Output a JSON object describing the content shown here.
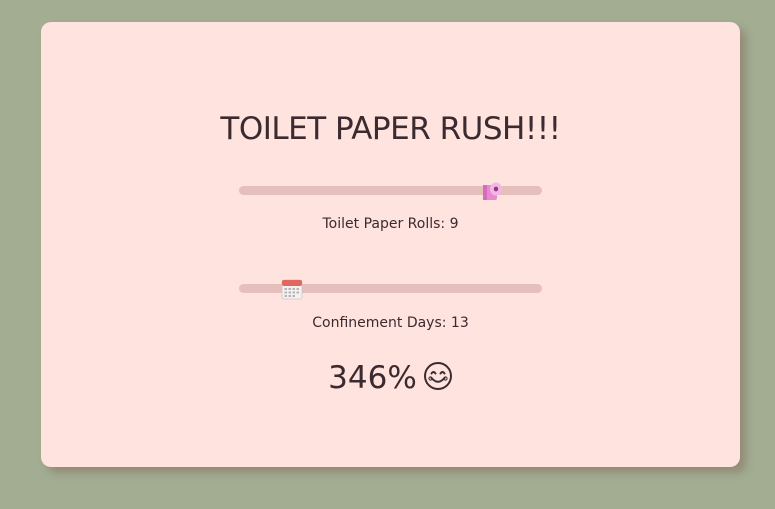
{
  "app": {
    "title": "TOILET PAPER RUSH!!!"
  },
  "rolls_slider": {
    "label_prefix": "Toilet Paper Rolls: ",
    "value": "9",
    "value_fraction": 0.86,
    "thumb_icon": "toilet-paper-roll-icon"
  },
  "days_slider": {
    "label_prefix": "Confinement Days: ",
    "value": "13",
    "value_fraction": 0.15,
    "thumb_icon": "calendar-icon"
  },
  "result": {
    "percentage": "346%",
    "mood_icon": "smiling-face-icon"
  },
  "colors": {
    "page_background": "#a2ad92",
    "card_background": "#ffe3de",
    "track": "#e5bfbb",
    "text": "#3b2a30",
    "roll_pink": "#e78ad0"
  }
}
